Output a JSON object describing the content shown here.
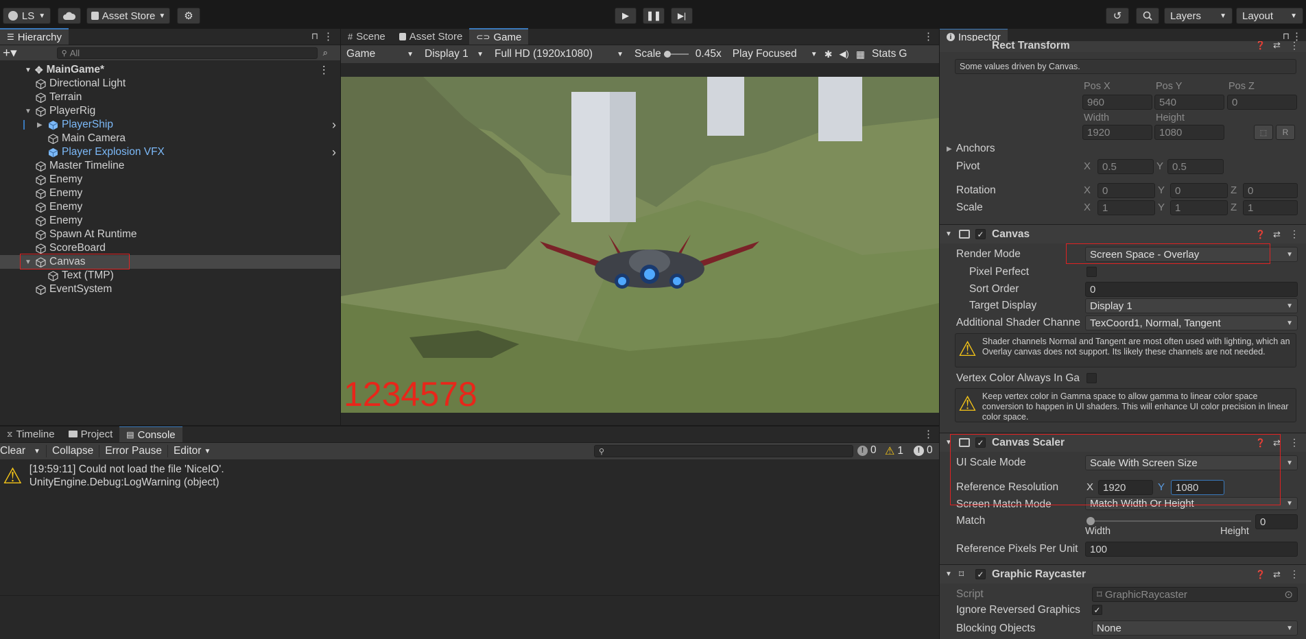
{
  "toolbar": {
    "account": "LS",
    "asset_store": "Asset Store",
    "layers": "Layers",
    "layout": "Layout"
  },
  "hierarchy": {
    "tab": "Hierarchy",
    "search_placeholder": "All",
    "scene": "MainGame*",
    "items": [
      {
        "label": "Directional Light"
      },
      {
        "label": "Terrain"
      },
      {
        "label": "PlayerRig"
      },
      {
        "label": "PlayerShip"
      },
      {
        "label": "Main Camera"
      },
      {
        "label": "Player Explosion VFX"
      },
      {
        "label": "Master Timeline"
      },
      {
        "label": "Enemy"
      },
      {
        "label": "Enemy"
      },
      {
        "label": "Enemy"
      },
      {
        "label": "Enemy"
      },
      {
        "label": "Spawn At Runtime"
      },
      {
        "label": "ScoreBoard"
      },
      {
        "label": "Canvas"
      },
      {
        "label": "Text (TMP)"
      },
      {
        "label": "EventSystem"
      }
    ]
  },
  "game": {
    "tabs": [
      "Scene",
      "Asset Store",
      "Game"
    ],
    "mode": "Game",
    "display": "Display 1",
    "resolution": "Full HD (1920x1080)",
    "scale_label": "Scale",
    "scale_value": "0.45x",
    "play_focused": "Play Focused",
    "stats": "Stats",
    "gizmos_cut": "G",
    "score_text": "1234578"
  },
  "console": {
    "tabs": [
      "Timeline",
      "Project",
      "Console"
    ],
    "clear": "Clear",
    "collapse": "Collapse",
    "error_pause": "Error Pause",
    "editor": "Editor",
    "count_log": "0",
    "count_warn": "1",
    "count_err": "0",
    "message_line1": "[19:59:11] Could not load the file 'NiceIO'.",
    "message_line2": "UnityEngine.Debug:LogWarning (object)"
  },
  "inspector": {
    "tab": "Inspector",
    "rect_title": "Rect Transform",
    "driven_note": "Some values driven by Canvas.",
    "pos_x_label": "Pos X",
    "pos_y_label": "Pos Y",
    "pos_z_label": "Pos Z",
    "pos_x": "960",
    "pos_y": "540",
    "pos_z": "0",
    "width_label": "Width",
    "height_label": "Height",
    "width": "1920",
    "height": "1080",
    "anchors": "Anchors",
    "pivot": "Pivot",
    "pivot_x": "0.5",
    "pivot_y": "0.5",
    "rotation": "Rotation",
    "rot_x": "0",
    "rot_y": "0",
    "rot_z": "0",
    "scale": "Scale",
    "scale_x": "1",
    "scale_y": "1",
    "scale_z": "1",
    "x": "X",
    "y": "Y",
    "z": "Z",
    "r": "R",
    "canvas_title": "Canvas",
    "render_mode_label": "Render Mode",
    "render_mode": "Screen Space - Overlay",
    "pixel_perfect": "Pixel Perfect",
    "sort_order_label": "Sort Order",
    "sort_order": "0",
    "target_display_label": "Target Display",
    "target_display": "Display 1",
    "shader_channels_label": "Additional Shader Channe",
    "shader_channels": "TexCoord1, Normal, Tangent",
    "warn1": "Shader channels Normal and Tangent are most often used with lighting, which an Overlay canvas does not support. Its likely these channels are not needed.",
    "vertex_color_label": "Vertex Color Always In Ga",
    "warn2": "Keep vertex color in Gamma space to allow gamma to linear color space conversion to happen in UI shaders. This will enhance UI color precision in linear color space.",
    "scaler_title": "Canvas Scaler",
    "ui_scale_mode_label": "UI Scale Mode",
    "ui_scale_mode": "Scale With Screen Size",
    "ref_res_label": "Reference Resolution",
    "ref_x": "1920",
    "ref_y": "1080",
    "match_mode_label": "Screen Match Mode",
    "match_mode": "Match Width Or Height",
    "match_label": "Match",
    "match_value": "0",
    "match_fraction": 0,
    "match_width": "Width",
    "match_height": "Height",
    "ref_ppu_label": "Reference Pixels Per Unit",
    "ref_ppu": "100",
    "raycaster_title": "Graphic Raycaster",
    "script_label": "Script",
    "script_value": "GraphicRaycaster",
    "ignore_reversed_label": "Ignore Reversed Graphics",
    "blocking_label": "Blocking Objects",
    "blocking_value": "None"
  },
  "colors": {
    "accent": "#3a79bb",
    "highlight_red": "#e02222",
    "score_red": "#e8261a",
    "warning_yellow": "#f5c518"
  }
}
